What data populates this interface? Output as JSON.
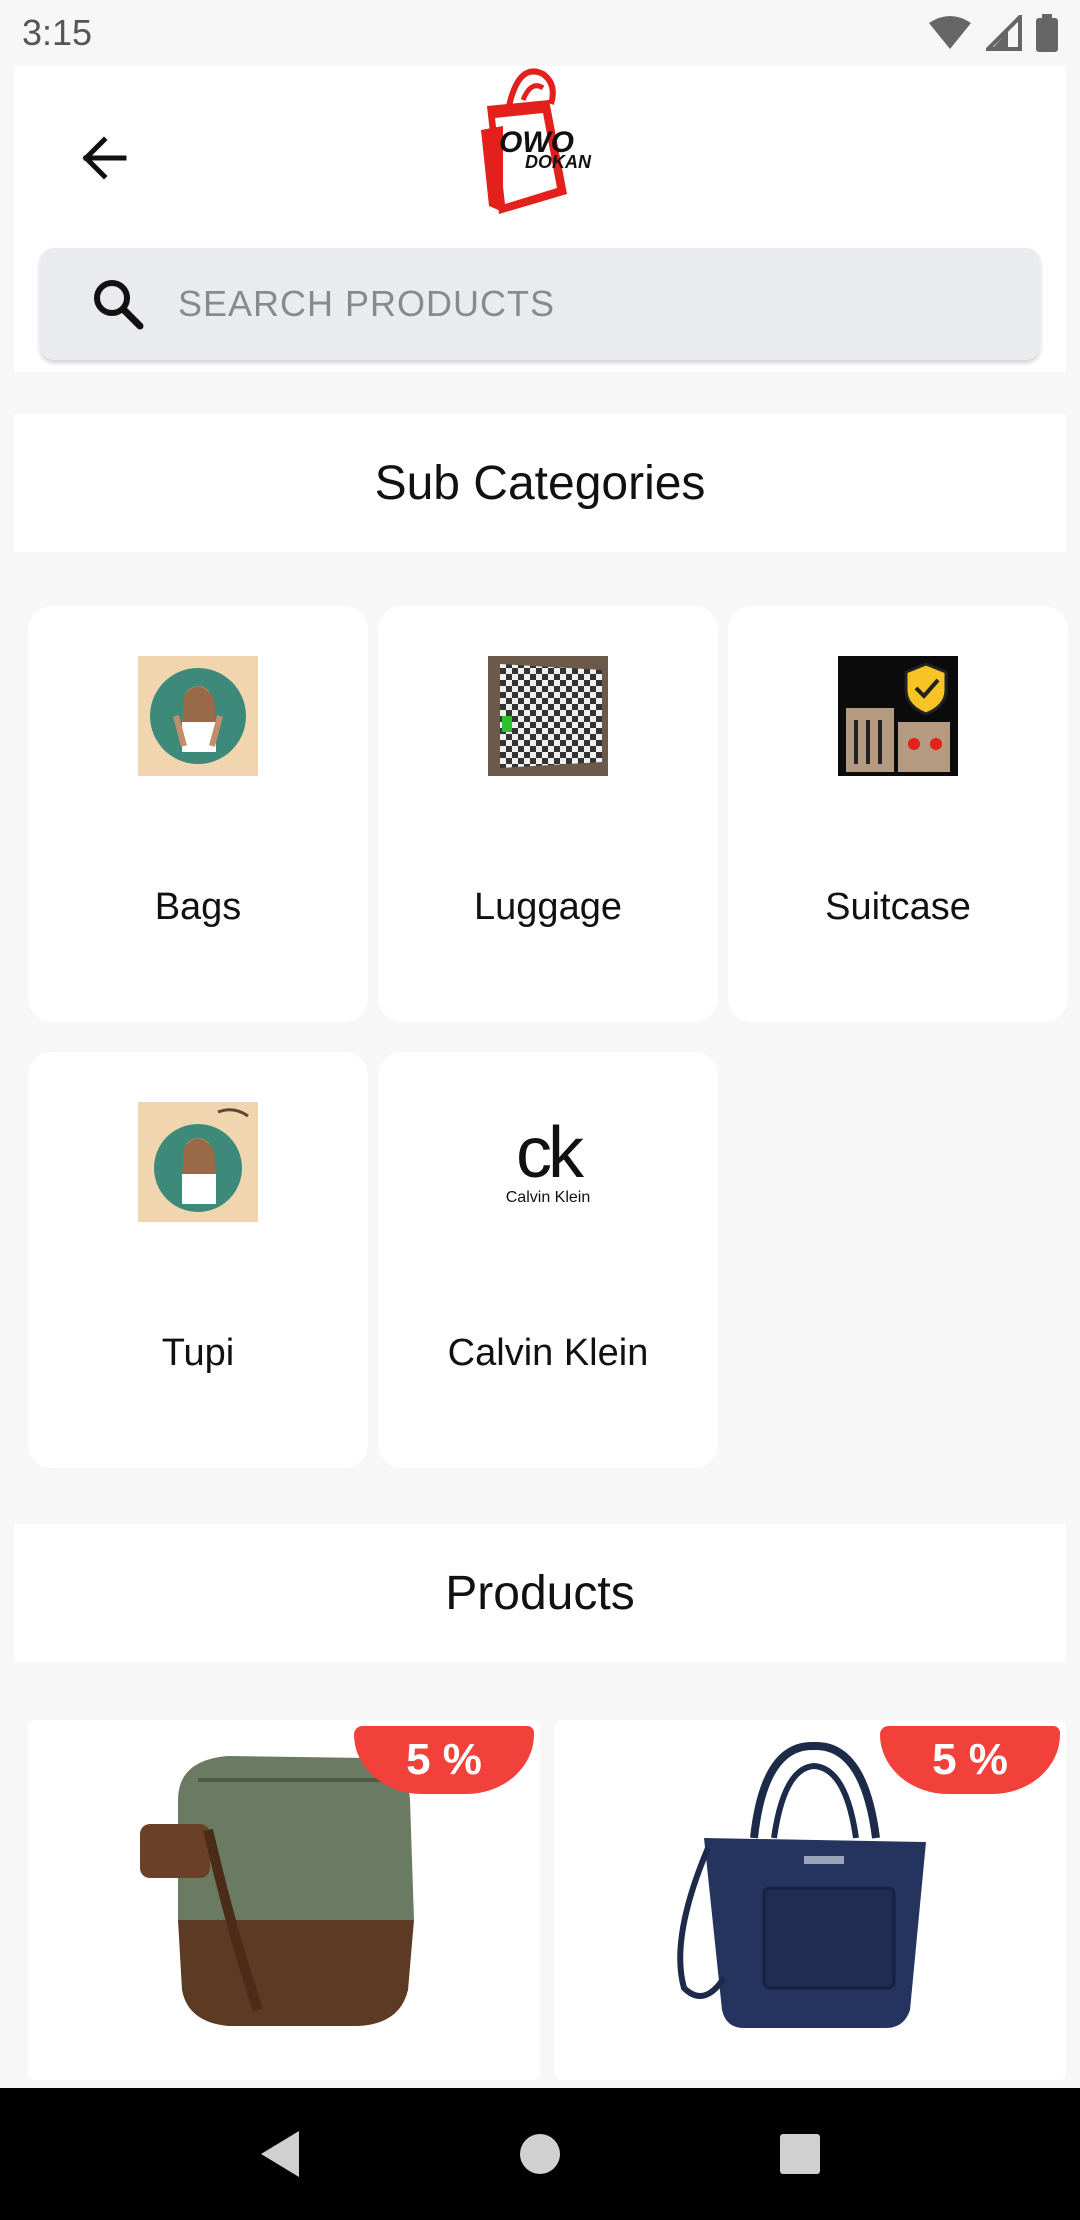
{
  "status_bar": {
    "time": "3:15"
  },
  "header": {
    "logo_text_top": "OWO",
    "logo_text_bottom": "DOKAN"
  },
  "search": {
    "placeholder": "SEARCH PRODUCTS"
  },
  "sub_categories": {
    "title": "Sub Categories",
    "items": [
      {
        "label": "Bags"
      },
      {
        "label": "Luggage"
      },
      {
        "label": "Suitcase"
      },
      {
        "label": "Tupi"
      },
      {
        "label": "Calvin Klein",
        "logo_text_main": "ck",
        "logo_text_sub": "Calvin Klein"
      }
    ]
  },
  "products": {
    "title": "Products",
    "items": [
      {
        "discount": "5 %"
      },
      {
        "discount": "5 %"
      }
    ]
  },
  "colors": {
    "accent_red": "#f2413a",
    "search_bg": "#e9ebee",
    "page_bg": "#f7f7f7"
  }
}
